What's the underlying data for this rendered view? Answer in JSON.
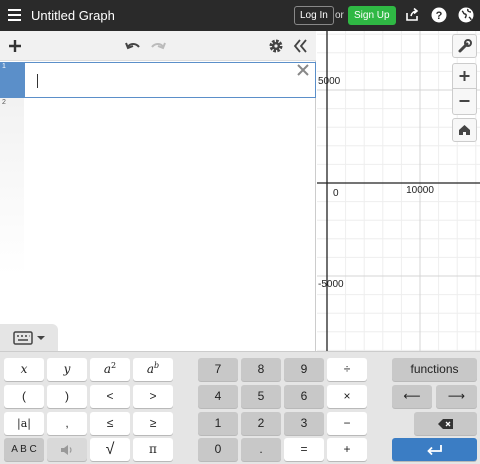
{
  "header": {
    "title": "Untitled Graph",
    "login_label": "Log In",
    "or_label": "or",
    "signup_label": "Sign Up",
    "colors": {
      "bar": "#2a2a2a",
      "signup": "#2fb844",
      "accent": "#5b8fc9"
    }
  },
  "expressions": {
    "rows": [
      {
        "index": "1",
        "value": ""
      },
      {
        "index": "2",
        "value": ""
      }
    ]
  },
  "graph": {
    "xlabels": [
      "0",
      "10000"
    ],
    "ylabels": [
      "5000",
      "-5000"
    ]
  },
  "keypad": {
    "keys": {
      "x": "x",
      "y": "y",
      "a2": "a",
      "a2_sup": "2",
      "ab": "a",
      "ab_sup": "b",
      "lparen": "(",
      "rparen": ")",
      "lt": "<",
      "gt": ">",
      "abs": "|a|",
      "comma": ",",
      "le": "≤",
      "ge": "≥",
      "abc": "A B C",
      "sqrt": "√",
      "pi": "π",
      "n7": "7",
      "n8": "8",
      "n9": "9",
      "div": "÷",
      "n4": "4",
      "n5": "5",
      "n6": "6",
      "mul": "×",
      "n1": "1",
      "n2": "2",
      "n3": "3",
      "minus": "−",
      "n0": "0",
      "dot": ".",
      "eq": "=",
      "plus": "+",
      "functions": "functions",
      "left": "⟵",
      "right": "⟶"
    }
  }
}
